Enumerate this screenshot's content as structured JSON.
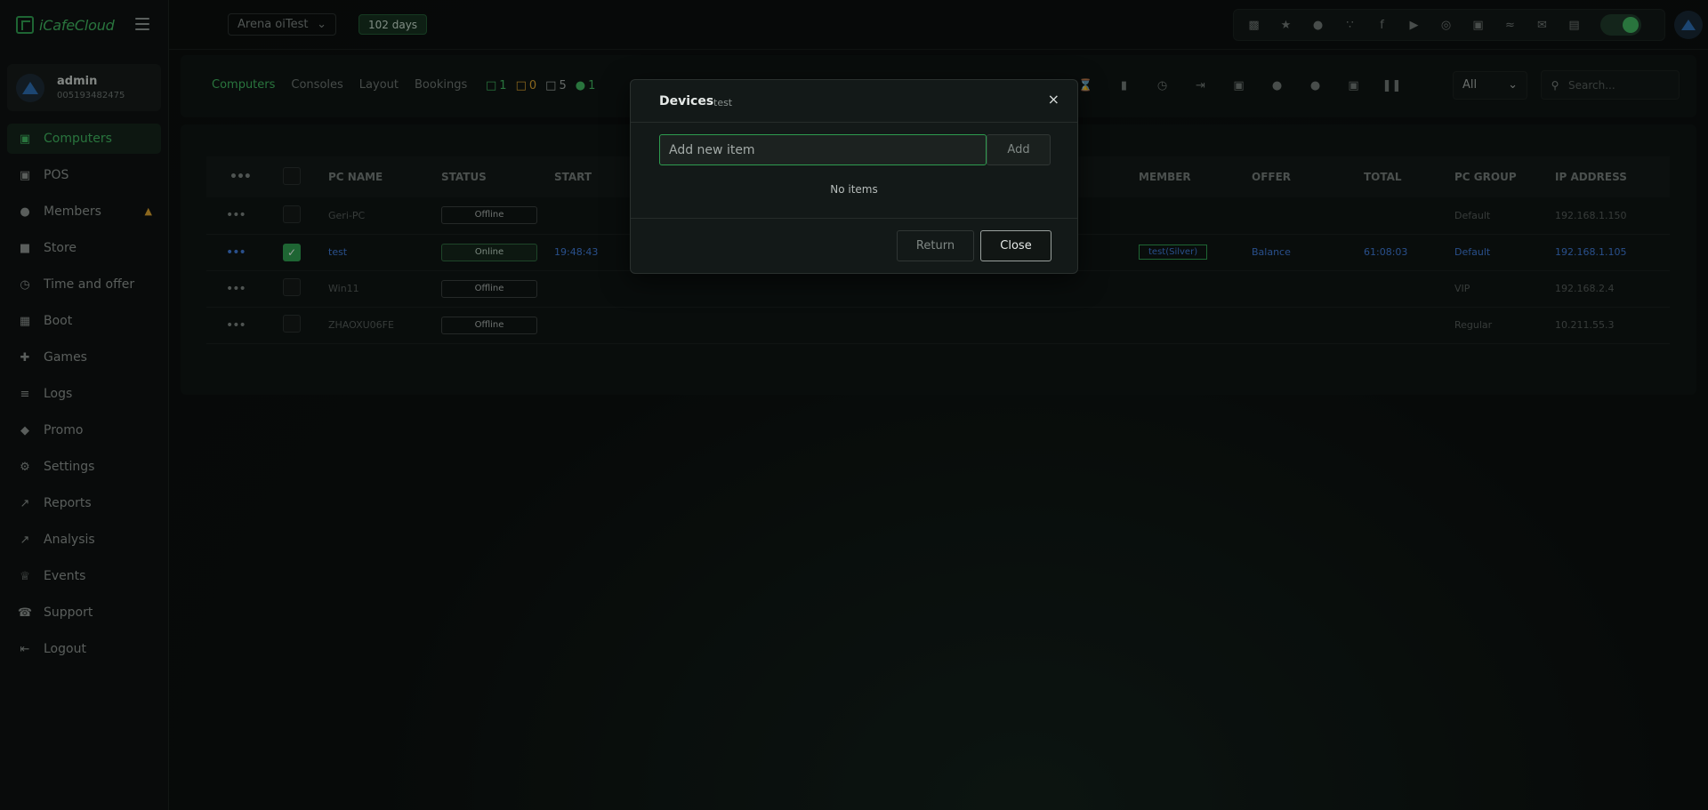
{
  "brand": {
    "name": "iCafeCloud"
  },
  "profile": {
    "name": "admin",
    "id": "005193482475"
  },
  "nav": {
    "items": [
      {
        "label": "Computers",
        "icon": "monitor-icon"
      },
      {
        "label": "POS",
        "icon": "pos-icon"
      },
      {
        "label": "Members",
        "icon": "users-icon"
      },
      {
        "label": "Store",
        "icon": "bag-icon"
      },
      {
        "label": "Time and offer",
        "icon": "clock-icon"
      },
      {
        "label": "Boot",
        "icon": "windows-icon"
      },
      {
        "label": "Games",
        "icon": "gamepad-icon"
      },
      {
        "label": "Logs",
        "icon": "list-icon"
      },
      {
        "label": "Promo",
        "icon": "tag-icon"
      },
      {
        "label": "Settings",
        "icon": "gear-icon"
      },
      {
        "label": "Reports",
        "icon": "chart-line-icon"
      },
      {
        "label": "Analysis",
        "icon": "chart-area-icon"
      },
      {
        "label": "Events",
        "icon": "crown-icon"
      },
      {
        "label": "Support",
        "icon": "phone-icon"
      },
      {
        "label": "Logout",
        "icon": "logout-icon"
      }
    ]
  },
  "topbar": {
    "branch": "Arena oiTest",
    "days": "102 days"
  },
  "toolbar": {
    "tabs": [
      "Computers",
      "Consoles",
      "Layout",
      "Bookings"
    ],
    "counters": {
      "green": "1",
      "amber": "0",
      "white": "5",
      "users": "1"
    },
    "filter": "All",
    "search_placeholder": "Search..."
  },
  "table": {
    "headers": {
      "pc_name": "PC NAME",
      "status": "STATUS",
      "start": "START",
      "member": "MEMBER",
      "offer": "OFFER",
      "total": "TOTAL",
      "pc_group": "PC GROUP",
      "ip": "IP ADDRESS"
    },
    "rows": [
      {
        "pc_name": "Geri-PC",
        "status": "Offline",
        "start": "",
        "member": "",
        "offer": "",
        "total": "",
        "pc_group": "Default",
        "ip": "192.168.1.150"
      },
      {
        "pc_name": "test",
        "status": "Online",
        "start": "19:48:43",
        "member": "test(Silver)",
        "offer": "Balance",
        "total": "61:08:03",
        "pc_group": "Default",
        "ip": "192.168.1.105"
      },
      {
        "pc_name": "Win11",
        "status": "Offline",
        "start": "",
        "member": "",
        "offer": "",
        "total": "",
        "pc_group": "VIP",
        "ip": "192.168.2.4"
      },
      {
        "pc_name": "ZHAOXU06FE",
        "status": "Offline",
        "start": "",
        "member": "",
        "offer": "",
        "total": "",
        "pc_group": "Regular",
        "ip": "10.211.55.3"
      }
    ]
  },
  "modal": {
    "title": "Devices",
    "subtitle": "test",
    "input_placeholder": "Add new item",
    "add_label": "Add",
    "empty_text": "No items",
    "return_label": "Return",
    "close_label": "Close"
  },
  "colors": {
    "accent": "#3fb35f",
    "link": "#3f7ad6",
    "warning": "#d69e2e"
  }
}
